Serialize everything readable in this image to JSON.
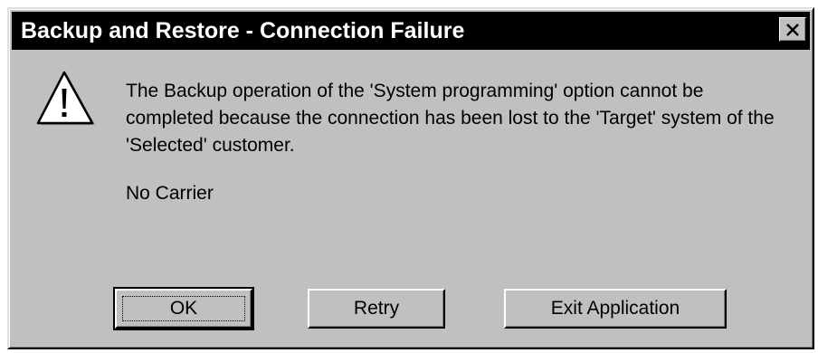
{
  "window": {
    "title": "Backup and Restore - Connection Failure",
    "close_icon": "close-icon"
  },
  "dialog": {
    "icon": "warning-icon",
    "message": "The Backup operation of the 'System programming' option cannot be completed because the connection has been lost to the 'Target' system of the 'Selected' customer.",
    "status": "No Carrier"
  },
  "buttons": {
    "ok": "OK",
    "retry": "Retry",
    "exit": "Exit Application"
  },
  "colors": {
    "face": "#c0c0c0",
    "titlebar": "#000000",
    "icon_fill": "#ffffff"
  }
}
